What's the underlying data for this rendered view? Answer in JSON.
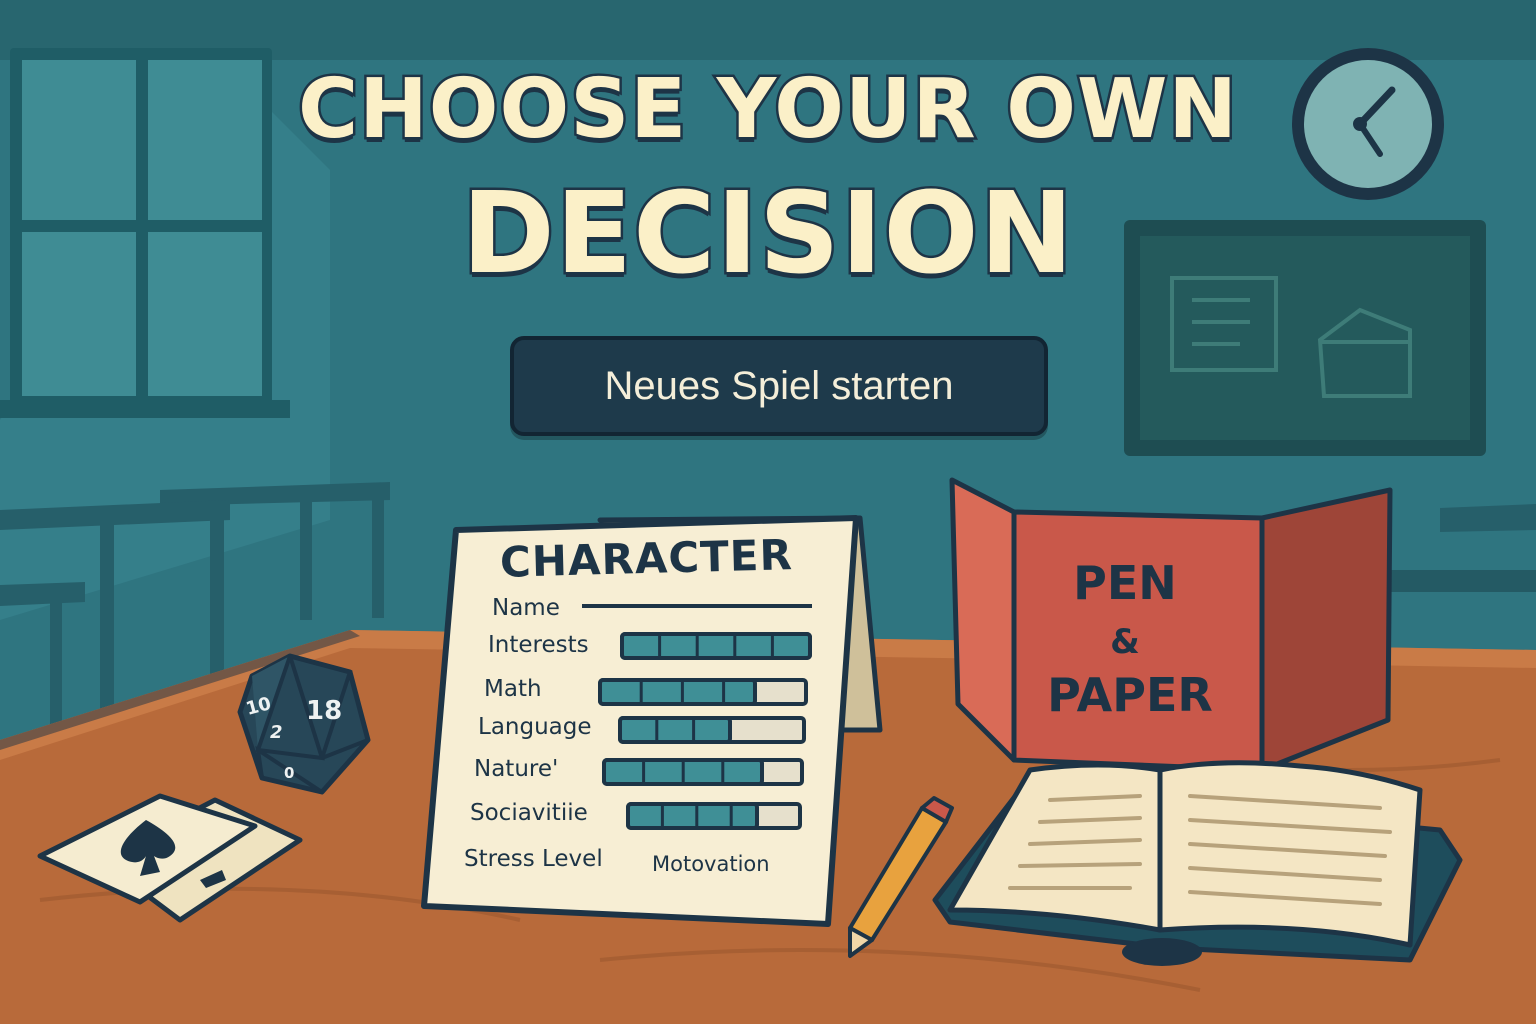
{
  "title": {
    "line1": "CHOOSE YOUR OWN",
    "line2": "DECISION"
  },
  "menu": {
    "start_label": "Neues Spiel starten"
  },
  "character_sheet": {
    "heading": "CHARACTER",
    "stats": [
      {
        "label": "Name"
      },
      {
        "label": "Interests",
        "level": 1.0
      },
      {
        "label": "Math",
        "level": 0.75
      },
      {
        "label": "Language",
        "level": 0.6
      },
      {
        "label": "Nature'",
        "level": 0.8
      },
      {
        "label": "Sociavitiie",
        "level": 0.75
      }
    ],
    "footer_left": "Stress Level",
    "footer_right": "Motovation"
  },
  "pen_paper_screen": {
    "line1": "PEN",
    "line2": "&",
    "line3": "PAPER"
  },
  "dice": {
    "top_face": "18",
    "left_face": "10",
    "center_face": "2",
    "bottom_face": "0"
  },
  "colors": {
    "wall": "#2f7580",
    "title_fill": "#fbf0c8",
    "outline": "#1d3446",
    "button": "#1e3a4b",
    "bar_fill": "#3f8f96",
    "screen_red": "#c9584a",
    "desk": "#b86a3a"
  },
  "icons": [
    "clock-icon",
    "d20-dice-icon",
    "spade-card-icon",
    "pencil-icon",
    "open-book-icon",
    "window-icon",
    "chalkboard-icon"
  ]
}
